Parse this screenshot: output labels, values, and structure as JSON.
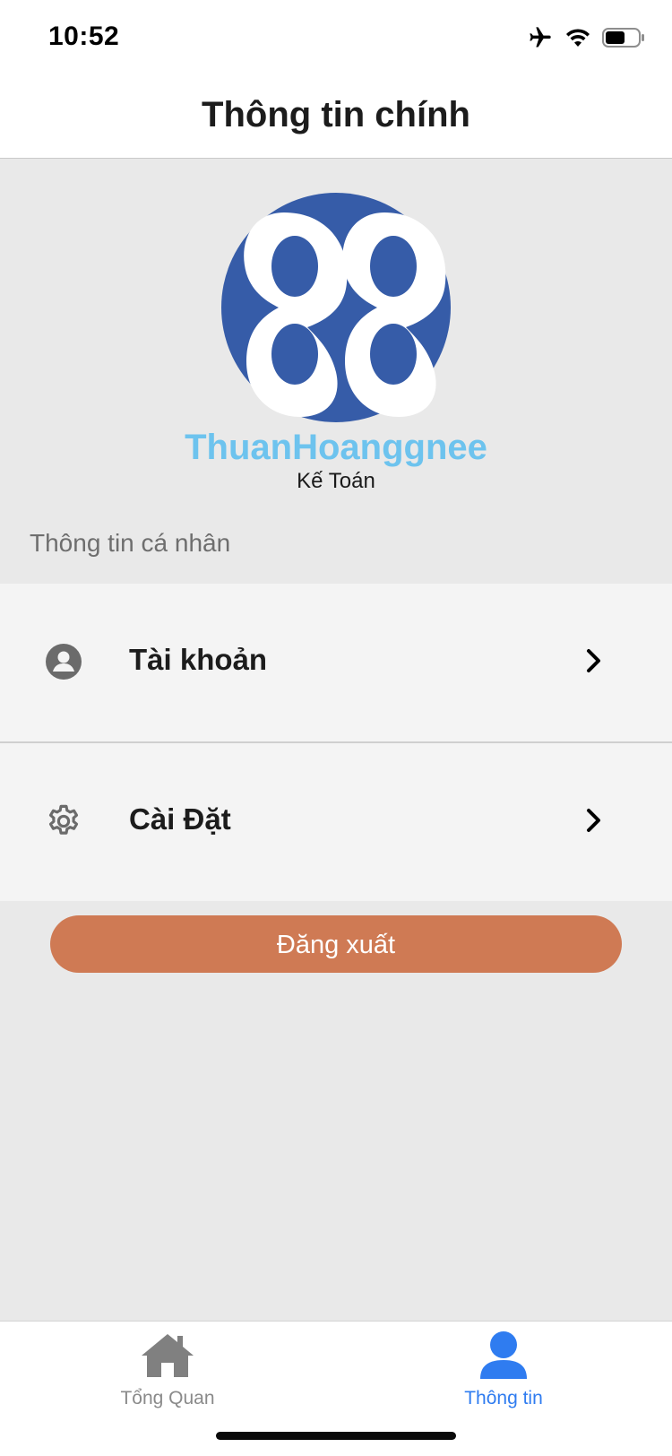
{
  "status_bar": {
    "time": "10:52",
    "icons": [
      "airplane-icon",
      "wifi-icon",
      "battery-icon"
    ],
    "battery_level": 0.6
  },
  "header": {
    "title": "Thông tin chính"
  },
  "profile": {
    "logo_icon": "logo-88-icon",
    "username": "ThuanHoanggnee",
    "role": "Kế Toán"
  },
  "section": {
    "label": "Thông tin cá nhân"
  },
  "menu": {
    "items": [
      {
        "label": "Tài khoản",
        "icon": "user-circle-icon"
      },
      {
        "label": "Cài Đặt",
        "icon": "gear-icon"
      }
    ]
  },
  "logout": {
    "label": "Đăng xuất"
  },
  "tab_bar": {
    "tabs": [
      {
        "label": "Tổng Quan",
        "icon": "home-icon",
        "active": false
      },
      {
        "label": "Thông tin",
        "icon": "user-icon",
        "active": true
      }
    ]
  },
  "colors": {
    "accent": "#2f7cf0",
    "logout": "#cf7a54",
    "username": "#6dc3ee",
    "logo_blue": "#365ca8"
  }
}
